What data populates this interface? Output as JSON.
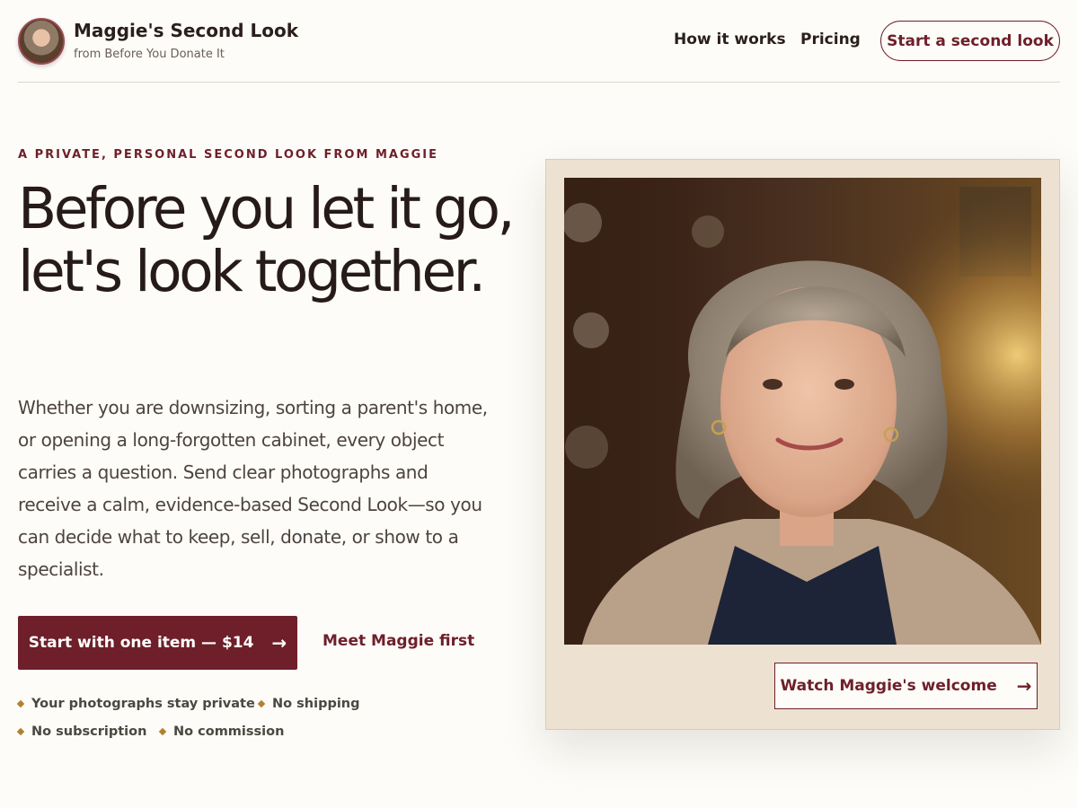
{
  "header": {
    "brand_name": "Maggie's Second Look",
    "brand_sub": "from Before You Donate It",
    "nav": [
      {
        "label": "How it works"
      },
      {
        "label": "Pricing"
      }
    ],
    "cta_label": "Start a second look"
  },
  "hero": {
    "eyebrow": "A PRIVATE, PERSONAL SECOND LOOK FROM MAGGIE",
    "headline": "Before you let it go, let's look together.",
    "lede": "Whether you are downsizing, sorting a parent's home, or opening a long-forgotten cabinet, every object carries a question. Send clear photographs and receive a calm, evidence-based Second Look—so you can decide what to keep, sell, donate, or show to a specialist.",
    "primary_label": "Start with one item — $14",
    "primary_icon": "arrow-right-icon",
    "secondary_label": "Meet Maggie first",
    "assurances": [
      "Your photographs stay private",
      "No shipping",
      "No subscription",
      "No commission"
    ]
  },
  "media": {
    "watch_label": "Watch Maggie's welcome",
    "watch_icon": "arrow-right-icon"
  },
  "colors": {
    "accent": "#6e1f2a",
    "bullet": "#b0812f",
    "card_bg": "#ede2d2",
    "page_bg": "#fdfcf8"
  }
}
